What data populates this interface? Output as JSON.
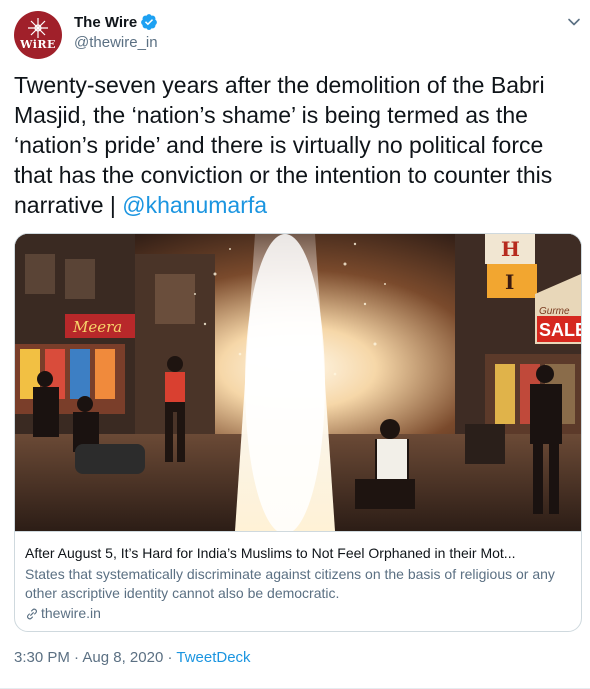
{
  "author": {
    "display_name": "The Wire",
    "handle": "@thewire_in",
    "avatar_text": "WiRE"
  },
  "tweet": {
    "text": "Twenty-seven years after the demolition of the Babri Masjid, the ‘nation’s shame’ is being termed as the ‘nation’s pride’ and there is virtually no political force that has the conviction or the intention to counter this narrative | ",
    "mention": "@khanumarfa"
  },
  "card": {
    "title": "After August 5, It’s Hard for India’s Muslims to Not Feel Orphaned in their Mot...",
    "description": "States that systematically discriminate against citizens on the basis of religious or any other ascriptive identity cannot also be democratic.",
    "domain": "thewire.in",
    "image_signs": {
      "shop_sign": "Meera",
      "sale_sign": "SALE",
      "gourmet_sign": "Gurme",
      "hotel_letter_1": "H",
      "hotel_letter_2": "I"
    }
  },
  "meta": {
    "time": "3:30 PM",
    "separator_1": " · ",
    "date": "Aug 8, 2020",
    "separator_2": " · ",
    "source": "TweetDeck"
  },
  "colors": {
    "link": "#1b95e0",
    "secondary": "#5b7083",
    "avatar_bg": "#a0202a",
    "verified": "#1da1f2"
  },
  "icons": {
    "verified": "verified-badge-icon",
    "caret": "chevron-down-icon",
    "link": "link-icon"
  }
}
